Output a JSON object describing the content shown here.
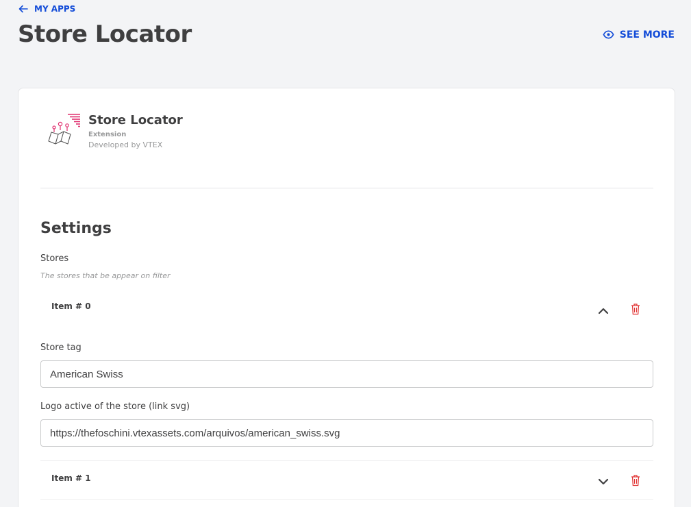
{
  "nav": {
    "back_label": "MY APPS"
  },
  "header": {
    "title": "Store Locator",
    "see_more_label": "SEE MORE"
  },
  "app": {
    "name": "Store Locator",
    "type": "Extension",
    "developer": "Developed by VTEX"
  },
  "settings": {
    "title": "Settings",
    "stores": {
      "label": "Stores",
      "description": "The stores that be appear on filter",
      "items": [
        {
          "label": "Item # 0",
          "expanded": true,
          "store_tag_label": "Store tag",
          "store_tag_value": "American Swiss",
          "logo_label": "Logo active of the store (link svg)",
          "logo_value": "https://thefoschini.vtexassets.com/arquivos/american_swiss.svg"
        },
        {
          "label": "Item # 1",
          "expanded": false
        }
      ]
    }
  },
  "colors": {
    "accent": "#134cd8",
    "danger": "#e13232",
    "text": "#3f3f40",
    "muted": "#979899",
    "background": "#f3f4f6",
    "border": "#cacbcc"
  },
  "icons": {
    "back": "arrow-left-icon",
    "see_more": "eye-icon",
    "collapse": "chevron-up-icon",
    "expand": "chevron-down-icon",
    "delete": "trash-icon"
  }
}
